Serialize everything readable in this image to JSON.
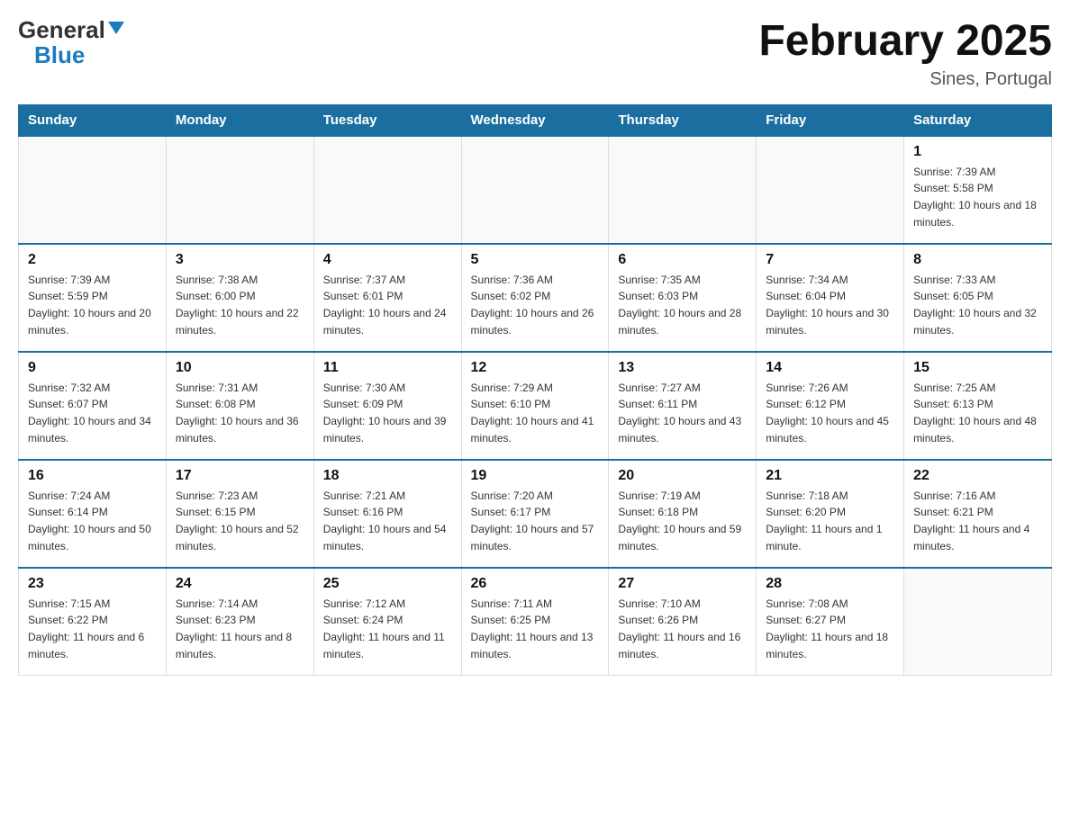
{
  "header": {
    "logo_general": "General",
    "logo_blue": "Blue",
    "month_title": "February 2025",
    "location": "Sines, Portugal"
  },
  "weekdays": [
    "Sunday",
    "Monday",
    "Tuesday",
    "Wednesday",
    "Thursday",
    "Friday",
    "Saturday"
  ],
  "weeks": [
    [
      {
        "day": "",
        "info": ""
      },
      {
        "day": "",
        "info": ""
      },
      {
        "day": "",
        "info": ""
      },
      {
        "day": "",
        "info": ""
      },
      {
        "day": "",
        "info": ""
      },
      {
        "day": "",
        "info": ""
      },
      {
        "day": "1",
        "info": "Sunrise: 7:39 AM\nSunset: 5:58 PM\nDaylight: 10 hours and 18 minutes."
      }
    ],
    [
      {
        "day": "2",
        "info": "Sunrise: 7:39 AM\nSunset: 5:59 PM\nDaylight: 10 hours and 20 minutes."
      },
      {
        "day": "3",
        "info": "Sunrise: 7:38 AM\nSunset: 6:00 PM\nDaylight: 10 hours and 22 minutes."
      },
      {
        "day": "4",
        "info": "Sunrise: 7:37 AM\nSunset: 6:01 PM\nDaylight: 10 hours and 24 minutes."
      },
      {
        "day": "5",
        "info": "Sunrise: 7:36 AM\nSunset: 6:02 PM\nDaylight: 10 hours and 26 minutes."
      },
      {
        "day": "6",
        "info": "Sunrise: 7:35 AM\nSunset: 6:03 PM\nDaylight: 10 hours and 28 minutes."
      },
      {
        "day": "7",
        "info": "Sunrise: 7:34 AM\nSunset: 6:04 PM\nDaylight: 10 hours and 30 minutes."
      },
      {
        "day": "8",
        "info": "Sunrise: 7:33 AM\nSunset: 6:05 PM\nDaylight: 10 hours and 32 minutes."
      }
    ],
    [
      {
        "day": "9",
        "info": "Sunrise: 7:32 AM\nSunset: 6:07 PM\nDaylight: 10 hours and 34 minutes."
      },
      {
        "day": "10",
        "info": "Sunrise: 7:31 AM\nSunset: 6:08 PM\nDaylight: 10 hours and 36 minutes."
      },
      {
        "day": "11",
        "info": "Sunrise: 7:30 AM\nSunset: 6:09 PM\nDaylight: 10 hours and 39 minutes."
      },
      {
        "day": "12",
        "info": "Sunrise: 7:29 AM\nSunset: 6:10 PM\nDaylight: 10 hours and 41 minutes."
      },
      {
        "day": "13",
        "info": "Sunrise: 7:27 AM\nSunset: 6:11 PM\nDaylight: 10 hours and 43 minutes."
      },
      {
        "day": "14",
        "info": "Sunrise: 7:26 AM\nSunset: 6:12 PM\nDaylight: 10 hours and 45 minutes."
      },
      {
        "day": "15",
        "info": "Sunrise: 7:25 AM\nSunset: 6:13 PM\nDaylight: 10 hours and 48 minutes."
      }
    ],
    [
      {
        "day": "16",
        "info": "Sunrise: 7:24 AM\nSunset: 6:14 PM\nDaylight: 10 hours and 50 minutes."
      },
      {
        "day": "17",
        "info": "Sunrise: 7:23 AM\nSunset: 6:15 PM\nDaylight: 10 hours and 52 minutes."
      },
      {
        "day": "18",
        "info": "Sunrise: 7:21 AM\nSunset: 6:16 PM\nDaylight: 10 hours and 54 minutes."
      },
      {
        "day": "19",
        "info": "Sunrise: 7:20 AM\nSunset: 6:17 PM\nDaylight: 10 hours and 57 minutes."
      },
      {
        "day": "20",
        "info": "Sunrise: 7:19 AM\nSunset: 6:18 PM\nDaylight: 10 hours and 59 minutes."
      },
      {
        "day": "21",
        "info": "Sunrise: 7:18 AM\nSunset: 6:20 PM\nDaylight: 11 hours and 1 minute."
      },
      {
        "day": "22",
        "info": "Sunrise: 7:16 AM\nSunset: 6:21 PM\nDaylight: 11 hours and 4 minutes."
      }
    ],
    [
      {
        "day": "23",
        "info": "Sunrise: 7:15 AM\nSunset: 6:22 PM\nDaylight: 11 hours and 6 minutes."
      },
      {
        "day": "24",
        "info": "Sunrise: 7:14 AM\nSunset: 6:23 PM\nDaylight: 11 hours and 8 minutes."
      },
      {
        "day": "25",
        "info": "Sunrise: 7:12 AM\nSunset: 6:24 PM\nDaylight: 11 hours and 11 minutes."
      },
      {
        "day": "26",
        "info": "Sunrise: 7:11 AM\nSunset: 6:25 PM\nDaylight: 11 hours and 13 minutes."
      },
      {
        "day": "27",
        "info": "Sunrise: 7:10 AM\nSunset: 6:26 PM\nDaylight: 11 hours and 16 minutes."
      },
      {
        "day": "28",
        "info": "Sunrise: 7:08 AM\nSunset: 6:27 PM\nDaylight: 11 hours and 18 minutes."
      },
      {
        "day": "",
        "info": ""
      }
    ]
  ]
}
